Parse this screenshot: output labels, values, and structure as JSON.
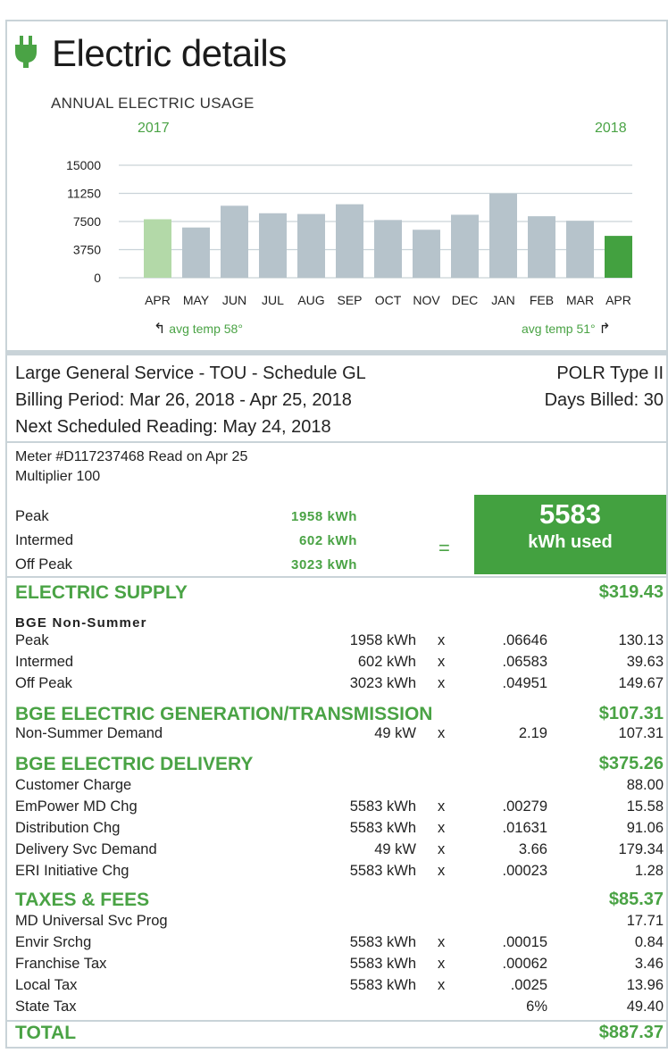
{
  "header": {
    "title": "Electric details",
    "icon": "plug-icon"
  },
  "colors": {
    "accent": "#4aa345",
    "bar": "#b6c3cb",
    "bar_first": "#b3d9a8",
    "bar_last": "#43a140",
    "grid": "#c9d3d8"
  },
  "chart_data": {
    "type": "bar",
    "title": "ANNUAL ELECTRIC USAGE",
    "year_start": "2017",
    "year_end": "2018",
    "categories": [
      "APR",
      "MAY",
      "JUN",
      "JUL",
      "AUG",
      "SEP",
      "OCT",
      "NOV",
      "DEC",
      "JAN",
      "FEB",
      "MAR",
      "APR"
    ],
    "values": [
      7800,
      6700,
      9600,
      8600,
      8500,
      9800,
      7700,
      6400,
      8400,
      11200,
      8200,
      7600,
      5583
    ],
    "yticks": [
      "15000",
      "11250",
      "7500",
      "3750",
      "0"
    ],
    "ylim": [
      0,
      15000
    ],
    "grid": true,
    "temp_start": "avg temp 58°",
    "temp_end": "avg temp 51°"
  },
  "account": {
    "service": "Large General Service - TOU - Schedule GL",
    "polr": "POLR Type II",
    "billing_period": "Billing Period: Mar 26, 2018 - Apr 25, 2018",
    "days_billed": "Days Billed: 30",
    "next_reading": "Next Scheduled Reading: May 24, 2018"
  },
  "meter": {
    "line1": "Meter #D117237468  Read on Apr 25",
    "line2": "Multiplier 100",
    "usage": [
      {
        "label": "Peak",
        "value": "1958 kWh"
      },
      {
        "label": "Intermed",
        "value": "602 kWh"
      },
      {
        "label": "Off Peak",
        "value": "3023 kWh"
      }
    ],
    "equals": "=",
    "total_kwh": "5583",
    "total_label": "kWh used"
  },
  "supply": {
    "title": "ELECTRIC SUPPLY",
    "total": "$319.43",
    "subhead": "BGE Non-Summer",
    "rows": [
      {
        "label": "Peak",
        "qty": "1958 kWh",
        "x": "x",
        "rate": ".06646",
        "amount": "130.13"
      },
      {
        "label": "Intermed",
        "qty": "602 kWh",
        "x": "x",
        "rate": ".06583",
        "amount": "39.63"
      },
      {
        "label": "Off Peak",
        "qty": "3023 kWh",
        "x": "x",
        "rate": ".04951",
        "amount": "149.67"
      }
    ]
  },
  "generation": {
    "title": "BGE ELECTRIC GENERATION/TRANSMISSION",
    "total": "$107.31",
    "rows": [
      {
        "label": "Non-Summer Demand",
        "qty": "49 kW",
        "x": "x",
        "rate": "2.19",
        "amount": "107.31"
      }
    ]
  },
  "delivery": {
    "title": "BGE ELECTRIC DELIVERY",
    "total": "$375.26",
    "rows": [
      {
        "label": "Customer Charge",
        "qty": "",
        "x": "",
        "rate": "",
        "amount": "88.00"
      },
      {
        "label": "EmPower MD Chg",
        "qty": "5583 kWh",
        "x": "x",
        "rate": ".00279",
        "amount": "15.58"
      },
      {
        "label": "Distribution Chg",
        "qty": "5583 kWh",
        "x": "x",
        "rate": ".01631",
        "amount": "91.06"
      },
      {
        "label": "Delivery Svc Demand",
        "qty": "49 kW",
        "x": "x",
        "rate": "3.66",
        "amount": "179.34"
      },
      {
        "label": "ERI Initiative Chg",
        "qty": "5583 kWh",
        "x": "x",
        "rate": ".00023",
        "amount": "1.28"
      }
    ]
  },
  "taxes": {
    "title": "TAXES & FEES",
    "total": "$85.37",
    "rows": [
      {
        "label": "MD Universal Svc Prog",
        "qty": "",
        "x": "",
        "rate": "",
        "amount": "17.71"
      },
      {
        "label": "Envir Srchg",
        "qty": "5583 kWh",
        "x": "x",
        "rate": ".00015",
        "amount": "0.84"
      },
      {
        "label": "Franchise Tax",
        "qty": "5583 kWh",
        "x": "x",
        "rate": ".00062",
        "amount": "3.46"
      },
      {
        "label": "Local Tax",
        "qty": "5583 kWh",
        "x": "x",
        "rate": ".0025",
        "amount": "13.96"
      },
      {
        "label": "State Tax",
        "qty": "",
        "x": "",
        "rate": "6%",
        "amount": "49.40"
      }
    ]
  },
  "total": {
    "label": "TOTAL",
    "amount": "$887.37"
  }
}
